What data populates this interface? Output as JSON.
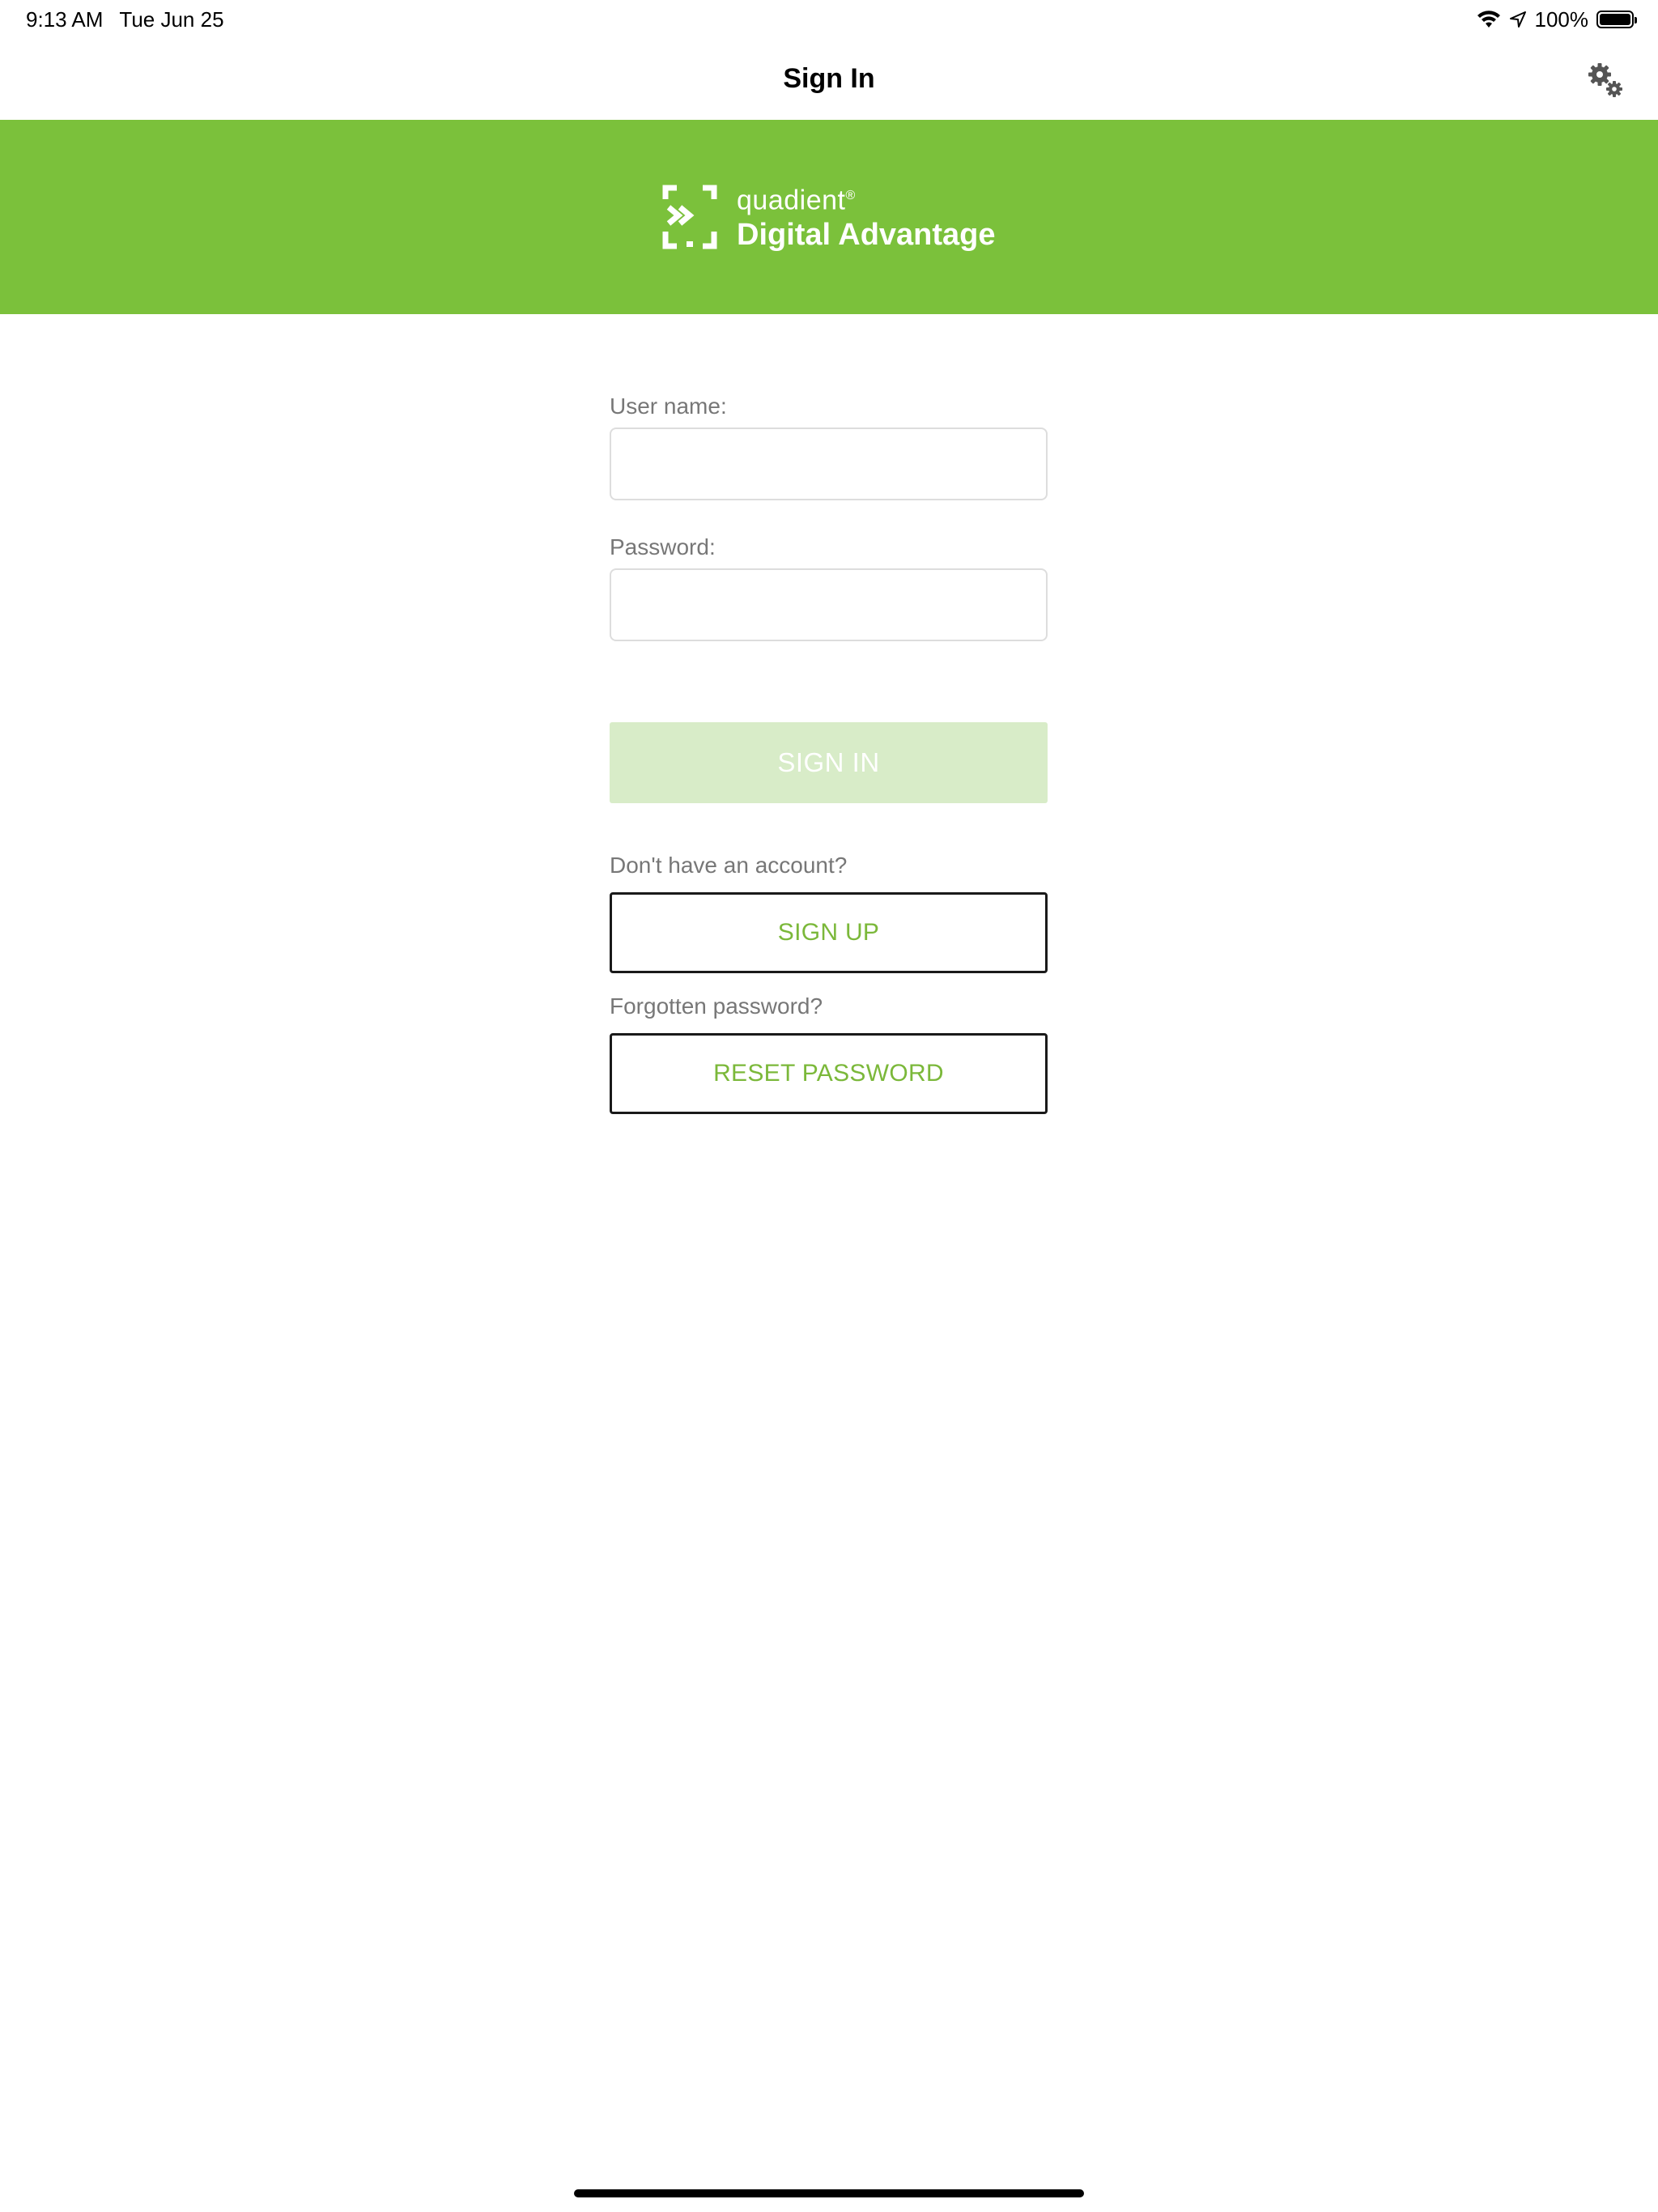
{
  "status_bar": {
    "time": "9:13 AM",
    "date": "Tue Jun 25",
    "battery_text": "100%",
    "icons": [
      "wifi-icon",
      "location-arrow-icon",
      "battery-icon"
    ]
  },
  "nav": {
    "title": "Sign In",
    "settings_icon": "gears-icon"
  },
  "brand": {
    "small": "quadient",
    "mark": "®",
    "large": "Digital Advantage",
    "color": "#7bc13b"
  },
  "form": {
    "username_label": "User name:",
    "username_value": "",
    "password_label": "Password:",
    "password_value": "",
    "sign_in_label": "SIGN IN",
    "no_account_text": "Don't have an account?",
    "sign_up_label": "SIGN UP",
    "forgot_text": "Forgotten password?",
    "reset_label": "RESET PASSWORD"
  },
  "colors": {
    "accent": "#7bc13b",
    "disabled_button": "#d8ecc8",
    "outline_text": "#7bb83a",
    "label_gray": "#777777"
  }
}
